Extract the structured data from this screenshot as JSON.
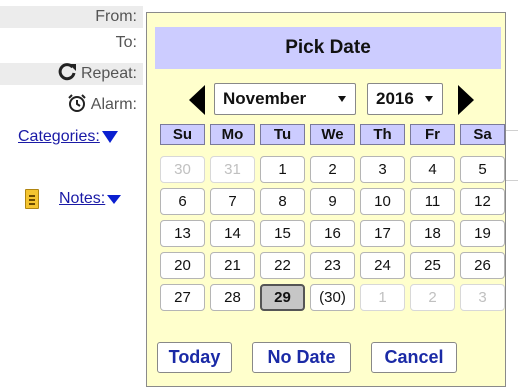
{
  "form": {
    "from_label": "From:",
    "to_label": "To:",
    "repeat_label": "Repeat:",
    "repeat_icon": "refresh-icon",
    "alarm_label": "Alarm:",
    "alarm_icon": "alarm-clock-icon",
    "categories_label": "Categories:",
    "notes_label": "Notes:",
    "notes_icon": "note-icon"
  },
  "picker": {
    "title": "Pick Date",
    "month": "November",
    "year": "2016",
    "weekdays": [
      "Su",
      "Mo",
      "Tu",
      "We",
      "Th",
      "Fr",
      "Sa"
    ],
    "weeks": [
      [
        {
          "d": "30",
          "dim": true
        },
        {
          "d": "31",
          "dim": true
        },
        {
          "d": "1"
        },
        {
          "d": "2"
        },
        {
          "d": "3"
        },
        {
          "d": "4"
        },
        {
          "d": "5"
        }
      ],
      [
        {
          "d": "6"
        },
        {
          "d": "7"
        },
        {
          "d": "8"
        },
        {
          "d": "9"
        },
        {
          "d": "10"
        },
        {
          "d": "11"
        },
        {
          "d": "12"
        }
      ],
      [
        {
          "d": "13"
        },
        {
          "d": "14"
        },
        {
          "d": "15"
        },
        {
          "d": "16"
        },
        {
          "d": "17"
        },
        {
          "d": "18"
        },
        {
          "d": "19"
        }
      ],
      [
        {
          "d": "20"
        },
        {
          "d": "21"
        },
        {
          "d": "22"
        },
        {
          "d": "23"
        },
        {
          "d": "24"
        },
        {
          "d": "25"
        },
        {
          "d": "26"
        }
      ],
      [
        {
          "d": "27"
        },
        {
          "d": "28"
        },
        {
          "d": "29",
          "selected": true
        },
        {
          "d": "(30)"
        },
        {
          "d": "1",
          "dim": true
        },
        {
          "d": "2",
          "dim": true
        },
        {
          "d": "3",
          "dim": true
        }
      ]
    ],
    "buttons": {
      "today": "Today",
      "no_date": "No Date",
      "cancel": "Cancel"
    }
  },
  "colors": {
    "title_bg": "#ccccff",
    "panel_bg": "#ffffcc",
    "link": "#1a2aa6",
    "selected_day": "#c6c6c6"
  }
}
